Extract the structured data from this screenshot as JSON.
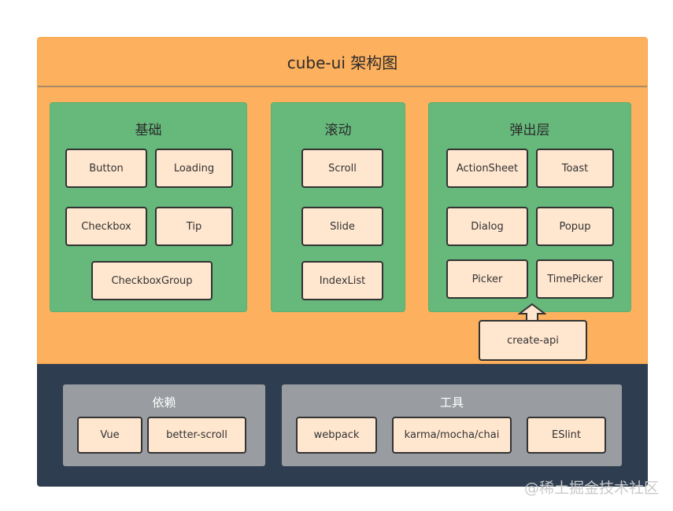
{
  "diagram": {
    "title": "cube-ui 架构图",
    "groups": [
      {
        "title": "基础",
        "items": [
          "Button",
          "Loading",
          "Checkbox",
          "Tip",
          "CheckboxGroup"
        ]
      },
      {
        "title": "滚动",
        "items": [
          "Scroll",
          "Slide",
          "IndexList"
        ]
      },
      {
        "title": "弹出层",
        "items": [
          "ActionSheet",
          "Toast",
          "Dialog",
          "Popup",
          "Picker",
          "TimePicker"
        ]
      }
    ],
    "create_api": "create-api",
    "bottom_groups": [
      {
        "title": "依赖",
        "items": [
          "Vue",
          "better-scroll"
        ]
      },
      {
        "title": "工具",
        "items": [
          "webpack",
          "karma/mocha/chai",
          "ESlint"
        ]
      }
    ],
    "colors": {
      "frame": "#fdb05d",
      "group": "#66b87b",
      "box": "#ffe6cf",
      "bottom": "#2e3e50",
      "bottom_panel": "#999da1"
    }
  },
  "watermark": "@稀土掘金技术社区"
}
